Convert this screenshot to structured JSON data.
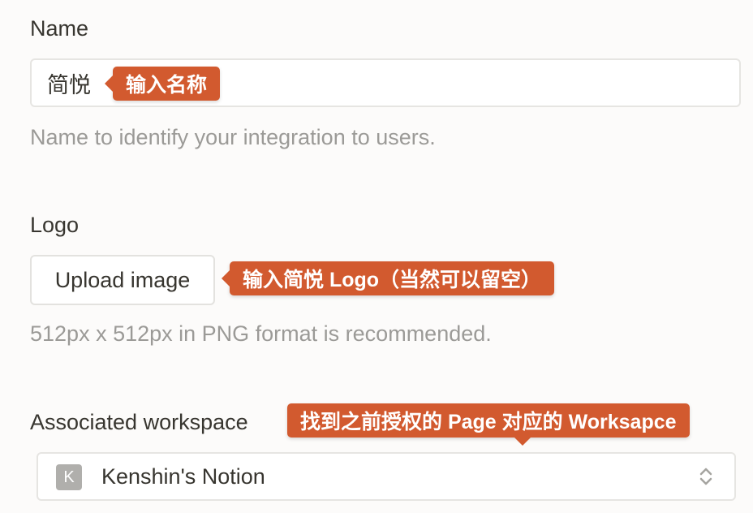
{
  "name_section": {
    "label": "Name",
    "input_value": "简悦",
    "hint": "Name to identify your integration to users.",
    "callout": "输入名称"
  },
  "logo_section": {
    "label": "Logo",
    "upload_label": "Upload image",
    "hint": "512px x 512px in PNG format is recommended.",
    "callout": "输入简悦 Logo（当然可以留空）"
  },
  "workspace_section": {
    "label": "Associated workspace",
    "workspace_initial": "K",
    "workspace_name": "Kenshin's Notion",
    "callout": "找到之前授权的 Page 对应的 Worksapce"
  },
  "colors": {
    "callout": "#d25a2f",
    "background": "#fcfbfa"
  }
}
